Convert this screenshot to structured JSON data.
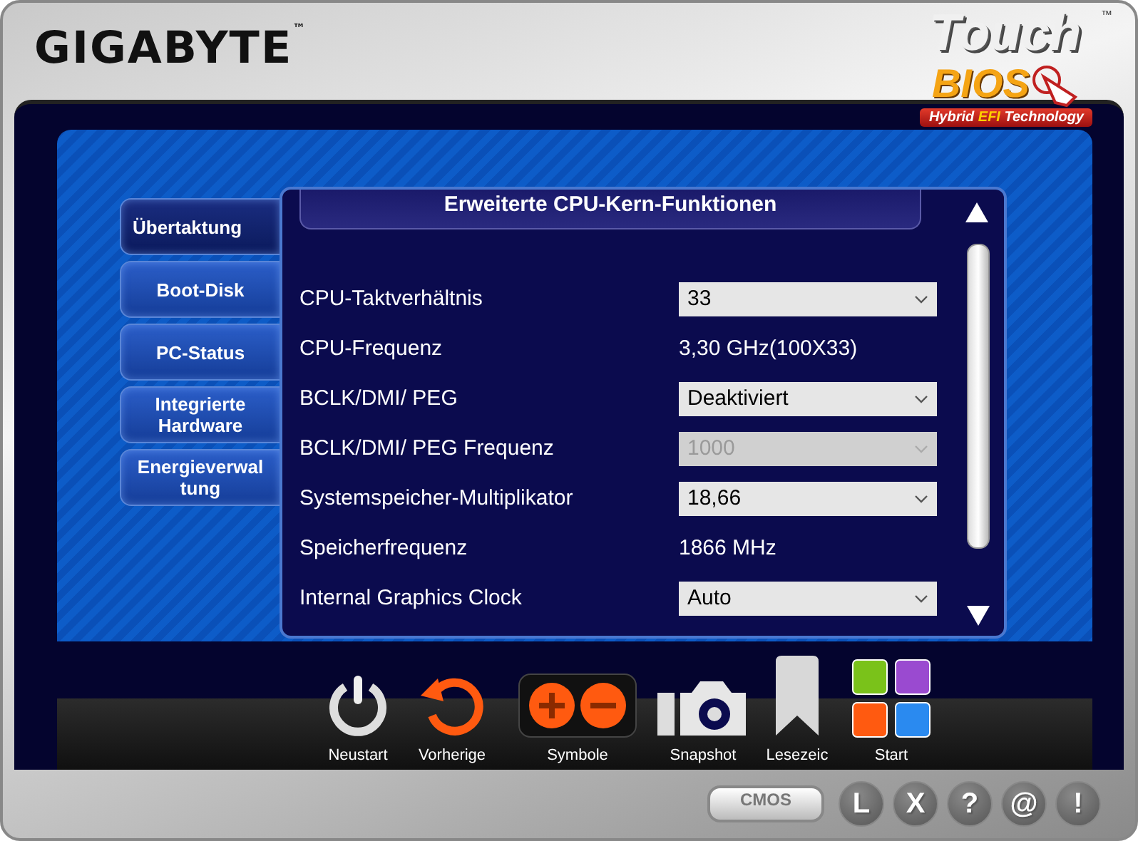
{
  "header": {
    "brand": "GIGABYTE",
    "brand_mark": "™",
    "product": {
      "line1": "Touch",
      "line2": "BIOS",
      "tagline_before": "Hybrid",
      "tagline_highlight": "EFI",
      "tagline_after": "Technology",
      "mark": "™"
    }
  },
  "sidebar": {
    "tabs": [
      {
        "label": "Übertaktung",
        "selected": true
      },
      {
        "label": "Boot-Disk",
        "selected": false
      },
      {
        "label": "PC-Status",
        "selected": false
      },
      {
        "label": "Integrierte Hardware",
        "selected": false
      },
      {
        "label": "Energieverwal tung",
        "selected": false
      }
    ]
  },
  "panel": {
    "title": "Erweiterte CPU-Kern-Funktionen",
    "rows": [
      {
        "kind": "select",
        "label": "CPU-Taktverhältnis",
        "value": "33",
        "disabled": false
      },
      {
        "kind": "value",
        "label": "CPU-Frequenz",
        "value": "3,30 GHz(100X33)"
      },
      {
        "kind": "select",
        "label": "BCLK/DMI/ PEG",
        "value": "Deaktiviert",
        "disabled": false
      },
      {
        "kind": "select",
        "label": "BCLK/DMI/ PEG Frequenz",
        "value": "1000",
        "disabled": true
      },
      {
        "kind": "select",
        "label": "Systemspeicher-Multiplikator",
        "value": "18,66",
        "disabled": false
      },
      {
        "kind": "value",
        "label": "Speicherfrequenz",
        "value": "1866 MHz"
      },
      {
        "kind": "select",
        "label": "Internal Graphics Clock",
        "value": "Auto",
        "disabled": false
      }
    ]
  },
  "dock": [
    {
      "kind": "power",
      "label": "Neustart"
    },
    {
      "kind": "undo",
      "label": "Vorherige"
    },
    {
      "kind": "zoom",
      "label": "Symbole"
    },
    {
      "kind": "camera",
      "label": "Snapshot"
    },
    {
      "kind": "bookmark",
      "label": "Lesezeic"
    },
    {
      "kind": "tiles",
      "label": "Start"
    }
  ],
  "footer": {
    "buttons": [
      {
        "kind": "pill",
        "label": "CMOS"
      },
      {
        "kind": "round",
        "label": "L"
      },
      {
        "kind": "round",
        "label": "X"
      },
      {
        "kind": "round",
        "label": "?"
      },
      {
        "kind": "round",
        "label": "@"
      },
      {
        "kind": "round",
        "label": "!"
      }
    ]
  }
}
